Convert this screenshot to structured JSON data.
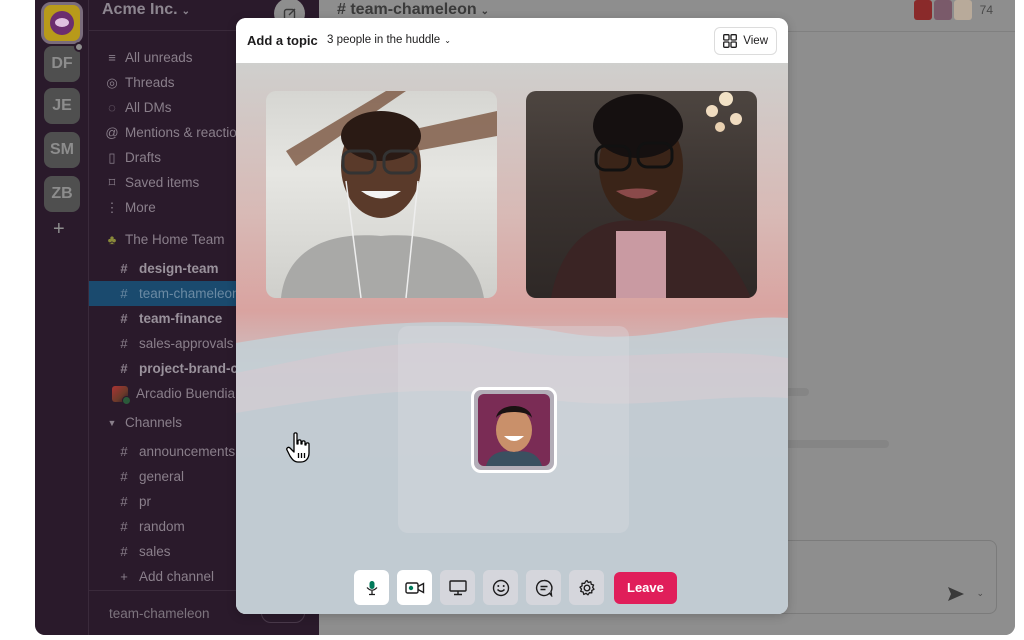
{
  "workspace": {
    "name": "Acme Inc.",
    "rail": [
      {
        "initials": "",
        "active": true,
        "icon": "workspace-logo"
      },
      {
        "initials": "DF",
        "badge": true
      },
      {
        "initials": "JE"
      },
      {
        "initials": "SM"
      },
      {
        "initials": "ZB"
      }
    ],
    "add_label": "+"
  },
  "sidebar": {
    "nav": [
      {
        "label": "All unreads",
        "icon": "list-icon"
      },
      {
        "label": "Threads",
        "icon": "threads-icon"
      },
      {
        "label": "All DMs",
        "icon": "dms-icon"
      },
      {
        "label": "Mentions & reactions",
        "icon": "at-icon"
      },
      {
        "label": "Drafts",
        "icon": "drafts-icon"
      },
      {
        "label": "Saved items",
        "icon": "bookmark-icon"
      },
      {
        "label": "More",
        "icon": "more-icon"
      }
    ],
    "section_home": {
      "label": "The Home Team",
      "icon": "plant-icon"
    },
    "home_channels": [
      {
        "label": "design-team",
        "bold": true
      },
      {
        "label": "team-chameleon",
        "selected": true
      },
      {
        "label": "team-finance",
        "bold": true
      },
      {
        "label": "sales-approvals"
      },
      {
        "label": "project-brand-campaign",
        "bold": true
      }
    ],
    "dm": {
      "label": "Arcadio Buendia"
    },
    "section_channels": {
      "label": "Channels"
    },
    "channels": [
      {
        "label": "announcements"
      },
      {
        "label": "general"
      },
      {
        "label": "pr"
      },
      {
        "label": "random"
      },
      {
        "label": "sales"
      }
    ],
    "add_channel": "Add channel",
    "footer_label": "team-chameleon"
  },
  "channel": {
    "title": "# team-chameleon",
    "member_count": "74"
  },
  "huddle": {
    "topic": "Add a topic",
    "people": "3 people in the huddle",
    "view_label": "View",
    "controls": [
      {
        "name": "mic",
        "on": true
      },
      {
        "name": "video",
        "on": true
      },
      {
        "name": "screen-share",
        "on": false
      },
      {
        "name": "reactions",
        "on": false
      },
      {
        "name": "thread",
        "on": false
      },
      {
        "name": "settings",
        "on": false
      }
    ],
    "leave_label": "Leave"
  },
  "colors": {
    "sidebar_bg": "#2a1a2b",
    "selected": "#1a4a6e",
    "leave": "#e01e5a",
    "active_icon": "#007a5a"
  }
}
